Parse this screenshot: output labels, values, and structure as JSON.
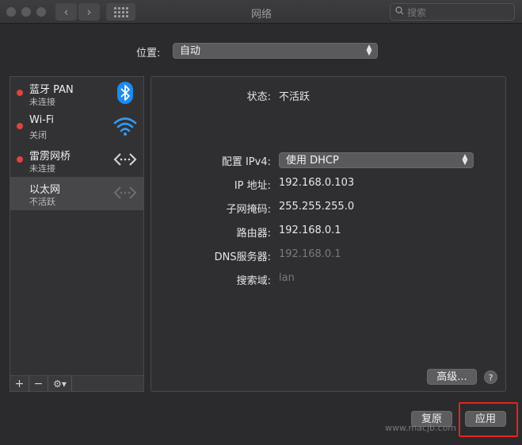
{
  "titlebar": {
    "title": "网络",
    "search_placeholder": "搜索",
    "back_glyph": "‹",
    "forward_glyph": "›"
  },
  "location": {
    "label": "位置:",
    "value": "自动"
  },
  "services": [
    {
      "name": "蓝牙 PAN",
      "status": "未连接",
      "icon": "bluetooth-icon",
      "status_color": "#e0443e"
    },
    {
      "name": "Wi-Fi",
      "status": "关闭",
      "icon": "wifi-icon",
      "status_color": "#e0443e"
    },
    {
      "name": "雷雳网桥",
      "status": "未连接",
      "icon": "bridge-arrows-icon",
      "status_color": "#e0443e"
    },
    {
      "name": "以太网",
      "status": "不活跃",
      "icon": "ethernet-arrows-icon",
      "selected": true
    }
  ],
  "sidebar_toolbar": {
    "add": "+",
    "remove": "−",
    "gear": "⚙▾"
  },
  "details": {
    "status_label": "状态:",
    "status_value": "不活跃",
    "config_label": "配置 IPv4:",
    "config_value": "使用 DHCP",
    "ip_label": "IP 地址:",
    "ip_value": "192.168.0.103",
    "subnet_label": "子网掩码:",
    "subnet_value": "255.255.255.0",
    "router_label": "路由器:",
    "router_value": "192.168.0.1",
    "dns_label": "DNS服务器:",
    "dns_value": "192.168.0.1",
    "search_domain_label": "搜索域:",
    "search_domain_value": "lan"
  },
  "buttons": {
    "advanced": "高级...",
    "help": "?",
    "revert": "复原",
    "apply": "应用"
  },
  "watermark": "www.macjb.com",
  "colors": {
    "status_red": "#e0443e",
    "bluetooth_blue": "#1e8bf0",
    "wifi_blue": "#2f9bf5",
    "highlight_red": "#e0251c"
  }
}
